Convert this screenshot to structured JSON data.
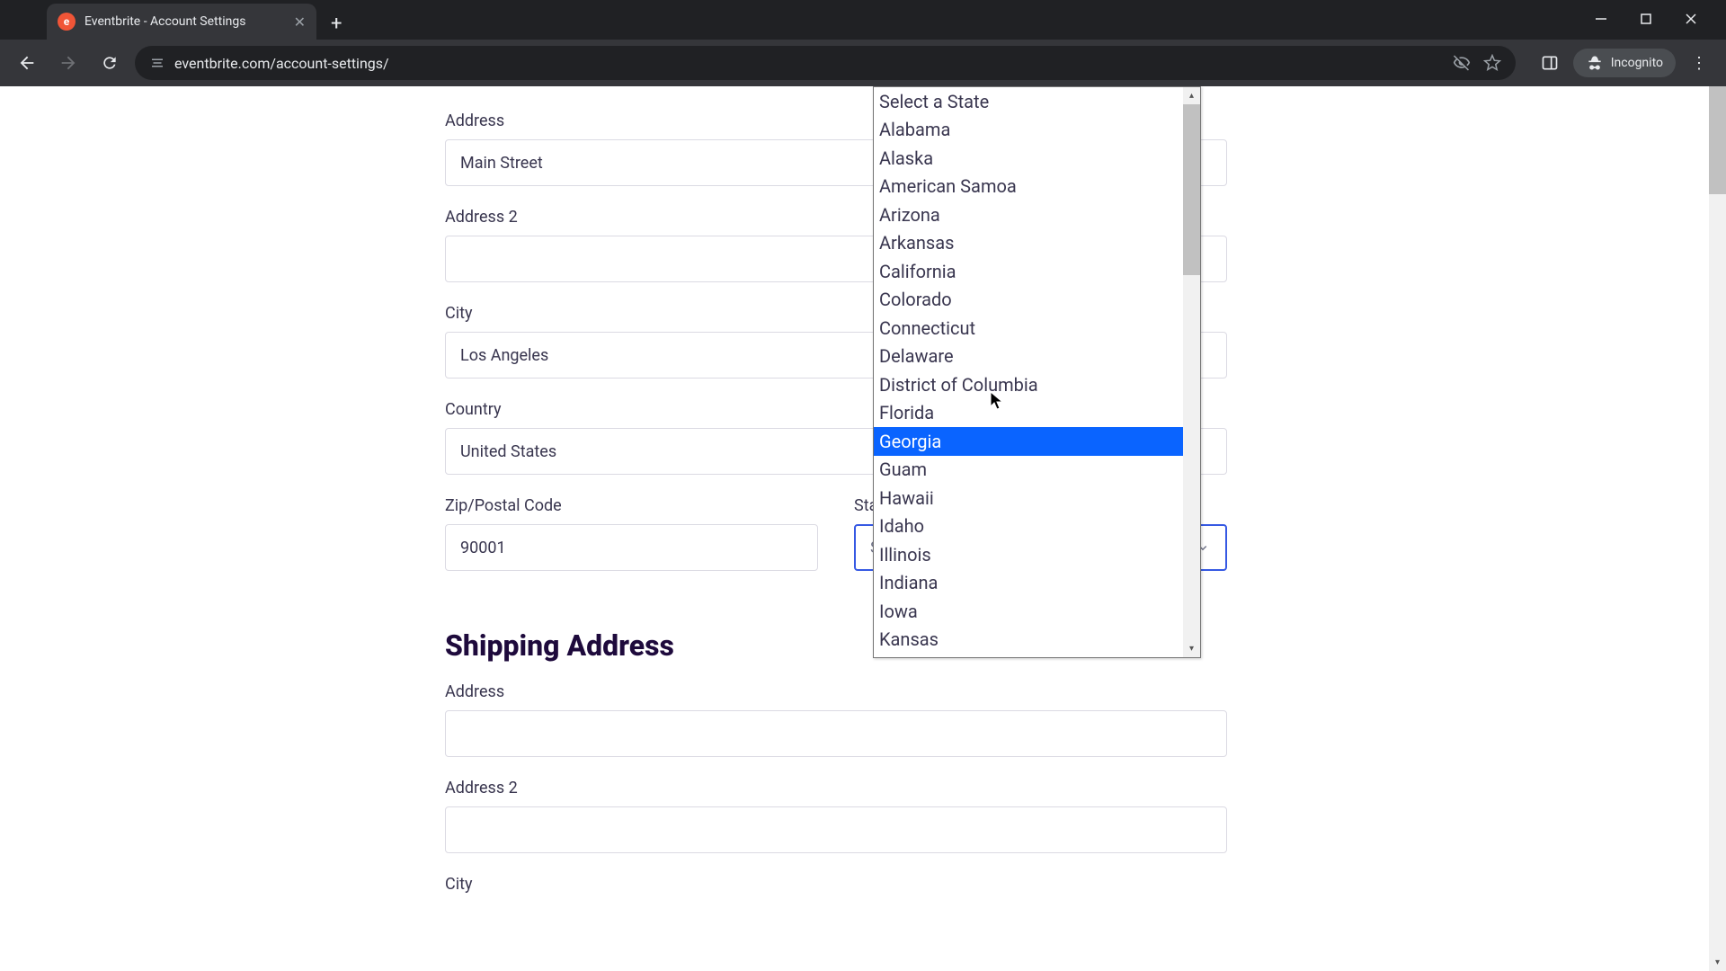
{
  "browser": {
    "tab_title": "Eventbrite - Account Settings",
    "url": "eventbrite.com/account-settings/",
    "incognito_label": "Incognito",
    "favicon_letter": "e"
  },
  "form": {
    "address": {
      "label": "Address",
      "value": "Main Street"
    },
    "address2": {
      "label": "Address 2",
      "value": ""
    },
    "city": {
      "label": "City",
      "value": "Los Angeles"
    },
    "country": {
      "label": "Country",
      "value": "United States"
    },
    "zip": {
      "label": "Zip/Postal Code",
      "value": "90001"
    },
    "state": {
      "label": "State",
      "value": "Select a State"
    }
  },
  "shipping": {
    "heading": "Shipping Address",
    "address": {
      "label": "Address",
      "value": ""
    },
    "address2": {
      "label": "Address 2",
      "value": ""
    },
    "city": {
      "label": "City",
      "value": ""
    }
  },
  "dropdown": {
    "highlighted_index": 13,
    "options": [
      "Select a State",
      "Alabama",
      "Alaska",
      "American Samoa",
      "Arizona",
      "Arkansas",
      "California",
      "Colorado",
      "Connecticut",
      "Delaware",
      "District of Columbia",
      "Florida",
      "Georgia",
      "Guam",
      "Hawaii",
      "Idaho",
      "Illinois",
      "Indiana",
      "Iowa",
      "Kansas"
    ]
  }
}
